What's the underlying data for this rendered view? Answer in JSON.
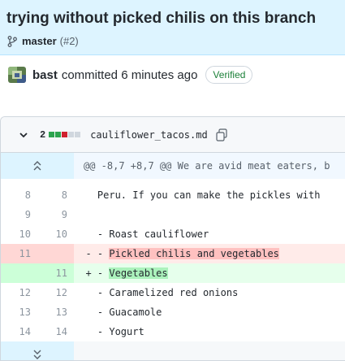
{
  "commit": {
    "title": "trying without picked chilis on this branch",
    "branch": "master",
    "pr": "(#2)",
    "author": "bast",
    "committed_text": "committed 6 minutes ago",
    "verified_label": "Verified"
  },
  "file": {
    "change_count": "2",
    "name": "cauliflower_tacos.md",
    "diffstat_colors": [
      "#2da44e",
      "#2da44e",
      "#cf222e",
      "#d0d7de",
      "#d0d7de"
    ],
    "hunk_header": "@@ -8,7 +8,7 @@ We are avid meat eaters, b",
    "lines": [
      {
        "old": "8",
        "new": "8",
        "prefix": " ",
        "text": " Peru. If you can make the pickles with"
      },
      {
        "old": "9",
        "new": "9",
        "prefix": " ",
        "text": ""
      },
      {
        "old": "10",
        "new": "10",
        "prefix": " ",
        "text": " - Roast cauliflower"
      },
      {
        "old": "11",
        "new": "",
        "prefix": "-",
        "text": " - ",
        "highlight": "Pickled chilis and vegetables"
      },
      {
        "old": "",
        "new": "11",
        "prefix": "+",
        "text": " - ",
        "highlight": "Vegetables"
      },
      {
        "old": "12",
        "new": "12",
        "prefix": " ",
        "text": " - Caramelized red onions"
      },
      {
        "old": "13",
        "new": "13",
        "prefix": " ",
        "text": " - Guacamole"
      },
      {
        "old": "14",
        "new": "14",
        "prefix": " ",
        "text": " - Yogurt"
      }
    ]
  }
}
